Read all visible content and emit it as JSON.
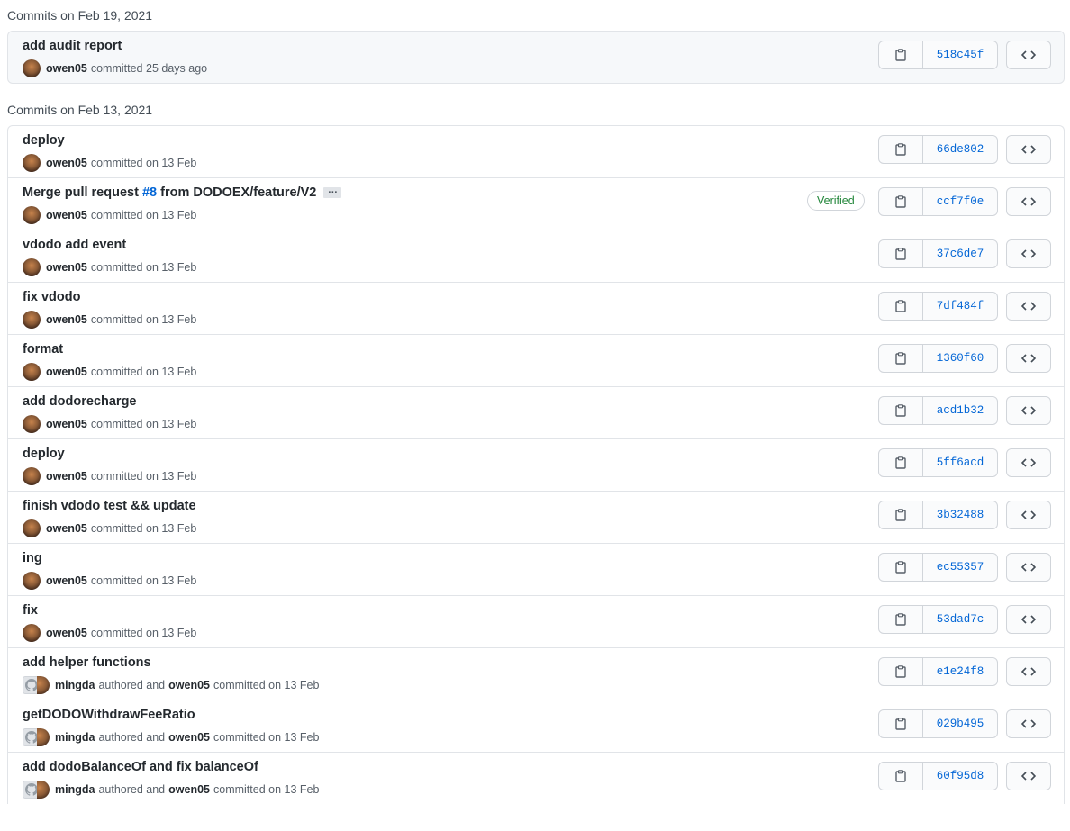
{
  "groups": [
    {
      "heading": "Commits on Feb 19, 2021",
      "commits": [
        {
          "message": "add audit report",
          "author": "owen05",
          "action": "committed 25 days ago",
          "sha": "518c45f"
        }
      ]
    },
    {
      "heading": "Commits on Feb 13, 2021",
      "commits": [
        {
          "message": "deploy",
          "author": "owen05",
          "action": "committed on 13 Feb",
          "sha": "66de802"
        },
        {
          "message_pre": "Merge pull request ",
          "pr": "#8",
          "message_post": " from DODOEX/feature/V2",
          "ellipsis": "…",
          "verified": "Verified",
          "author": "owen05",
          "action": "committed on 13 Feb",
          "sha": "ccf7f0e"
        },
        {
          "message": "vdodo add event",
          "author": "owen05",
          "action": "committed on 13 Feb",
          "sha": "37c6de7"
        },
        {
          "message": "fix vdodo",
          "author": "owen05",
          "action": "committed on 13 Feb",
          "sha": "7df484f"
        },
        {
          "message": "format",
          "author": "owen05",
          "action": "committed on 13 Feb",
          "sha": "1360f60"
        },
        {
          "message": "add dodorecharge",
          "author": "owen05",
          "action": "committed on 13 Feb",
          "sha": "acd1b32"
        },
        {
          "message": "deploy",
          "author": "owen05",
          "action": "committed on 13 Feb",
          "sha": "5ff6acd"
        },
        {
          "message": "finish vdodo test && update",
          "author": "owen05",
          "action": "committed on 13 Feb",
          "sha": "3b32488"
        },
        {
          "message": "ing",
          "author": "owen05",
          "action": "committed on 13 Feb",
          "sha": "ec55357"
        },
        {
          "message": "fix",
          "author": "owen05",
          "action": "committed on 13 Feb",
          "sha": "53dad7c"
        },
        {
          "message": "add helper functions",
          "author": "mingda",
          "authored": "authored and",
          "committer": "owen05",
          "action": "committed on 13 Feb",
          "sha": "e1e24f8"
        },
        {
          "message": "getDODOWithdrawFeeRatio",
          "author": "mingda",
          "authored": "authored and",
          "committer": "owen05",
          "action": "committed on 13 Feb",
          "sha": "029b495"
        },
        {
          "message": "add dodoBalanceOf and fix balanceOf",
          "author": "mingda",
          "authored": "authored and",
          "committer": "owen05",
          "action": "committed on 13 Feb",
          "sha": "60f95d8"
        }
      ]
    }
  ],
  "icons": {
    "copy": "clipboard-icon",
    "browse": "code-icon",
    "github_avatar": "github-mark-icon"
  },
  "colors": {
    "link": "#0366d6",
    "verified": "#22863a",
    "border": "#e1e4e8"
  }
}
